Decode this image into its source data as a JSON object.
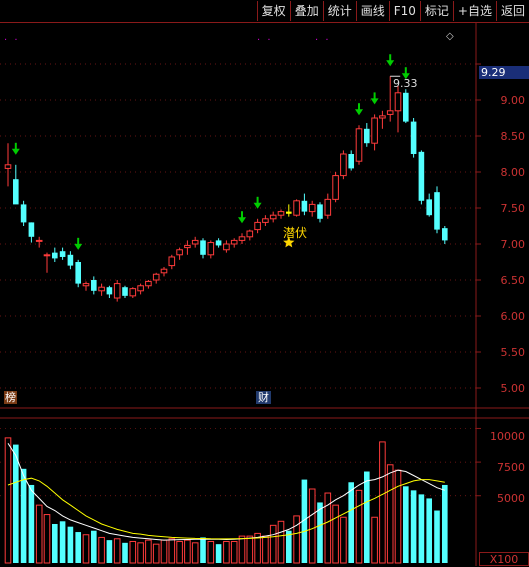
{
  "toolbar": {
    "buttons": [
      "复权",
      "叠加",
      "统计",
      "画线",
      "F10",
      "标记",
      "+自选",
      "返回"
    ]
  },
  "price_axis": {
    "labels": [
      "9.50",
      "9.00",
      "8.50",
      "8.00",
      "7.50",
      "7.00",
      "6.50",
      "6.00",
      "5.50",
      "5.00"
    ],
    "current_price": "9.29"
  },
  "volume_axis": {
    "labels": [
      "10000",
      "7500",
      "5000"
    ],
    "unit": "X100"
  },
  "annotations": {
    "high_label": "9.33",
    "qianfu": "潜伏",
    "bang_tag": "榜",
    "cai_tag": "财",
    "dots": "· ·"
  },
  "colors": {
    "up": "#ff3b3b",
    "down": "#54ffff",
    "arrow": "#00cc00",
    "ma1": "#ffffff",
    "ma2": "#ffff00",
    "grid": "#8a1a1a",
    "highlight": "#ffff00"
  },
  "chart_data": {
    "type": "candlestick",
    "candles": [
      [
        8.05,
        8.4,
        7.8,
        8.1
      ],
      [
        7.9,
        8.1,
        7.85,
        7.55
      ],
      [
        7.55,
        7.6,
        7.25,
        7.3
      ],
      [
        7.3,
        7.3,
        7.02,
        7.1
      ],
      [
        7.05,
        7.1,
        6.95,
        7.05
      ],
      [
        6.85,
        6.88,
        6.6,
        6.85
      ],
      [
        6.88,
        6.95,
        6.75,
        6.8
      ],
      [
        6.9,
        6.95,
        6.78,
        6.82
      ],
      [
        6.85,
        6.9,
        6.65,
        6.7
      ],
      [
        6.75,
        6.78,
        6.4,
        6.45
      ],
      [
        6.42,
        6.48,
        6.35,
        6.45
      ],
      [
        6.5,
        6.55,
        6.3,
        6.35
      ],
      [
        6.35,
        6.45,
        6.28,
        6.4
      ],
      [
        6.4,
        6.42,
        6.25,
        6.3
      ],
      [
        6.25,
        6.5,
        6.2,
        6.45
      ],
      [
        6.4,
        6.42,
        6.25,
        6.28
      ],
      [
        6.28,
        6.4,
        6.25,
        6.38
      ],
      [
        6.35,
        6.45,
        6.3,
        6.42
      ],
      [
        6.42,
        6.5,
        6.38,
        6.48
      ],
      [
        6.5,
        6.6,
        6.45,
        6.58
      ],
      [
        6.6,
        6.68,
        6.55,
        6.65
      ],
      [
        6.7,
        6.85,
        6.65,
        6.82
      ],
      [
        6.85,
        6.95,
        6.78,
        6.92
      ],
      [
        6.95,
        7.05,
        6.85,
        6.98
      ],
      [
        7.0,
        7.1,
        6.95,
        7.05
      ],
      [
        7.05,
        7.08,
        6.8,
        6.85
      ],
      [
        6.85,
        7.05,
        6.8,
        7.02
      ],
      [
        7.05,
        7.08,
        6.95,
        6.98
      ],
      [
        6.92,
        7.05,
        6.88,
        7.0
      ],
      [
        7.0,
        7.08,
        6.95,
        7.05
      ],
      [
        7.05,
        7.15,
        7.0,
        7.1
      ],
      [
        7.1,
        7.2,
        7.05,
        7.18
      ],
      [
        7.2,
        7.35,
        7.15,
        7.3
      ],
      [
        7.3,
        7.4,
        7.25,
        7.35
      ],
      [
        7.35,
        7.45,
        7.3,
        7.4
      ],
      [
        7.4,
        7.48,
        7.35,
        7.45
      ],
      [
        7.45,
        7.55,
        7.38,
        7.42
      ],
      [
        7.4,
        7.62,
        7.38,
        7.6
      ],
      [
        7.6,
        7.7,
        7.4,
        7.45
      ],
      [
        7.45,
        7.6,
        7.38,
        7.55
      ],
      [
        7.55,
        7.58,
        7.3,
        7.35
      ],
      [
        7.4,
        7.7,
        7.35,
        7.62
      ],
      [
        7.62,
        8.0,
        7.58,
        7.95
      ],
      [
        7.95,
        8.3,
        7.9,
        8.25
      ],
      [
        8.25,
        8.3,
        8.02,
        8.05
      ],
      [
        8.15,
        8.65,
        8.1,
        8.6
      ],
      [
        8.6,
        8.68,
        8.35,
        8.4
      ],
      [
        8.4,
        8.8,
        8.3,
        8.75
      ],
      [
        8.75,
        8.85,
        8.6,
        8.78
      ],
      [
        8.8,
        9.33,
        8.7,
        8.85
      ],
      [
        8.85,
        9.2,
        8.55,
        9.1
      ],
      [
        9.1,
        9.15,
        8.68,
        8.7
      ],
      [
        8.7,
        8.75,
        8.2,
        8.25
      ],
      [
        8.28,
        8.3,
        7.55,
        7.6
      ],
      [
        7.62,
        7.7,
        7.38,
        7.4
      ],
      [
        7.72,
        7.8,
        7.15,
        7.2
      ],
      [
        7.22,
        7.25,
        7.0,
        7.05
      ]
    ],
    "volume": [
      9300,
      8800,
      7000,
      5800,
      4300,
      3600,
      2900,
      3100,
      2700,
      2300,
      2100,
      2400,
      1900,
      1700,
      1800,
      1500,
      1600,
      1500,
      1700,
      1400,
      1700,
      1800,
      1600,
      1700,
      1500,
      1900,
      1600,
      1400,
      1600,
      1600,
      2000,
      2000,
      2200,
      2000,
      2800,
      3100,
      2400,
      3500,
      6200,
      5500,
      4500,
      5200,
      4300,
      3400,
      6000,
      5400,
      6800,
      3400,
      9000,
      7300,
      6900,
      5700,
      5400,
      5100,
      4800,
      3900,
      5800
    ],
    "ma_vol_1": [
      8900,
      8000,
      6500,
      5400,
      4800,
      4200,
      3900,
      3500,
      3200,
      3000,
      2800,
      2600,
      2400,
      2200,
      2100,
      2000,
      1900,
      1850,
      1800,
      1750,
      1700,
      1720,
      1740,
      1750,
      1760,
      1780,
      1770,
      1760,
      1750,
      1760,
      1800,
      1850,
      1900,
      2000,
      2100,
      2300,
      2500,
      2800,
      3200,
      3600,
      4000,
      4300,
      4700,
      5000,
      5400,
      5800,
      6100,
      6200,
      6400,
      6700,
      6900,
      6800,
      6500,
      6200,
      5900,
      5600,
      5400
    ],
    "ma_vol_2": [
      5800,
      6000,
      6200,
      6300,
      6100,
      5700,
      5200,
      4700,
      4300,
      3900,
      3500,
      3200,
      2900,
      2700,
      2500,
      2350,
      2200,
      2150,
      2050,
      2000,
      1950,
      1900,
      1870,
      1850,
      1830,
      1820,
      1800,
      1790,
      1790,
      1800,
      1810,
      1830,
      1860,
      1900,
      1950,
      2020,
      2100,
      2200,
      2350,
      2550,
      2800,
      3050,
      3350,
      3650,
      3950,
      4250,
      4550,
      4800,
      5100,
      5400,
      5700,
      5900,
      6100,
      6200,
      6200,
      6100,
      6000
    ],
    "arrow_candles": [
      1,
      9,
      30,
      32,
      45,
      47,
      49,
      51
    ],
    "highlight_candle": 36,
    "ylim_price": [
      4.8,
      9.65
    ],
    "ylim_volume": [
      0,
      11000
    ]
  }
}
